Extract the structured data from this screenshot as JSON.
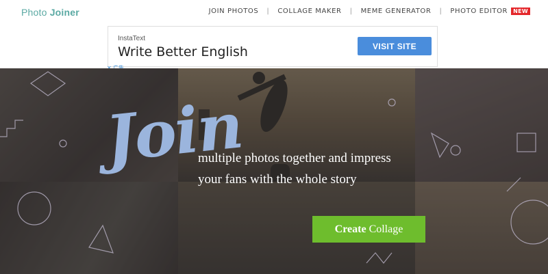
{
  "header": {
    "logo_part1": "Photo",
    "logo_part2": "Joiner",
    "nav": {
      "join_photos": "JOIN PHOTOS",
      "collage_maker": "COLLAGE MAKER",
      "meme_generator": "MEME GENERATOR",
      "photo_editor": "PHOTO EDITOR",
      "new_badge": "NEW"
    }
  },
  "ad": {
    "brand": "InstaText",
    "headline": "Write Better English",
    "cta": "VISIT SITE",
    "adchoices": "✕ 广告"
  },
  "hero": {
    "script_word": "Join",
    "tagline_line1": "multiple photos together and impress",
    "tagline_line2": "your fans with the whole story",
    "create_bold": "Create",
    "create_rest": "Collage"
  },
  "colors": {
    "brand": "#5aa9a3",
    "cta_ad": "#4a8ddc",
    "cta_create": "#6ebd2d",
    "script": "#9bb5dd",
    "badge": "#e4262a"
  }
}
